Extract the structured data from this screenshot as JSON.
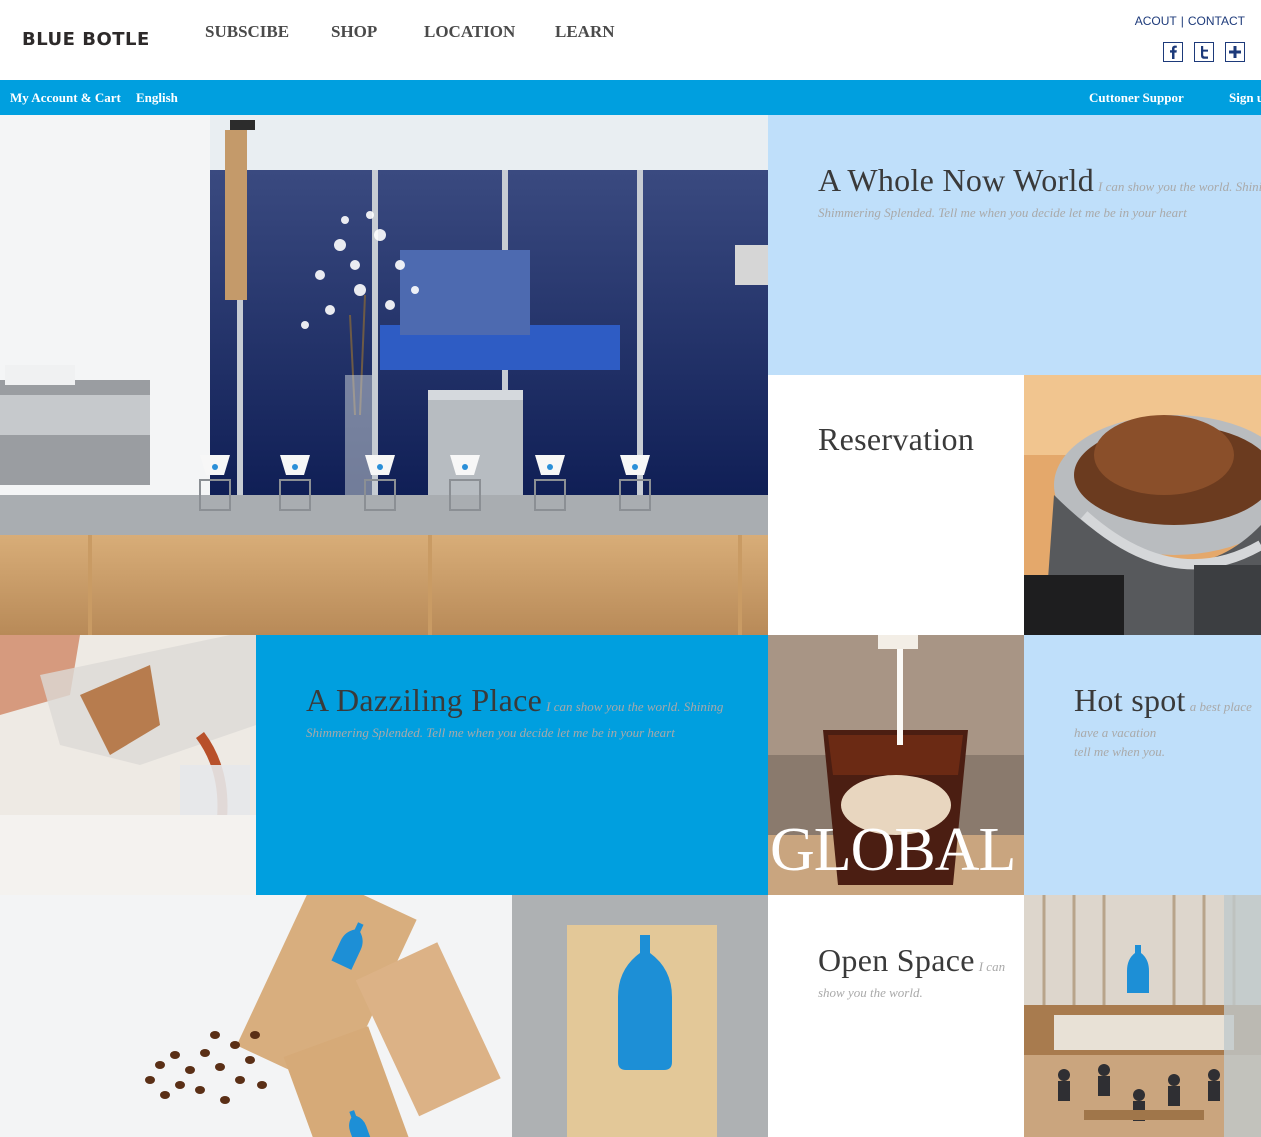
{
  "header": {
    "logo": "BLUE BOTLE",
    "nav": [
      "SUBSCIBE",
      "SHOP",
      "LOCATION",
      "LEARN"
    ],
    "top_links": {
      "account": "ACOUT",
      "separator": "|",
      "contact": "CONTACT"
    },
    "social_icons": [
      "facebook-icon",
      "twitter-icon",
      "plus-icon"
    ],
    "accent_color": "#1d3a7a"
  },
  "bar": {
    "color": "#009fdf",
    "left_links": [
      "My Account & Cart",
      "English"
    ],
    "right_links": [
      "Cuttoner Suppor",
      "Sign u"
    ]
  },
  "tiles": {
    "whole_world": {
      "title": "A Whole Now World",
      "subtitle_line1": "I can show you the world. Shinin",
      "subtitle_line2": "Shimmering Splended. Tell me when you decide let me be in your heart",
      "bg": "#bfdffa"
    },
    "reservation": {
      "title": "Reservation"
    },
    "dazzling": {
      "title": "A Dazziling Place",
      "subtitle_line1": "I can show you the world. Shining",
      "subtitle_line2": "Shimmering Splended. Tell me when you decide let me be in your heart",
      "bg": "#009fdf"
    },
    "global": {
      "label": "GLOBAL"
    },
    "hot_spot": {
      "title": "Hot spot",
      "subtitle_line1": "a best place",
      "subtitle_line2": "have a vacation",
      "subtitle_line3": "tell me when you.",
      "bg": "#bfdffa"
    },
    "open_space": {
      "title": "Open Space",
      "subtitle_line1": "I can",
      "subtitle_line2": "show you the world."
    }
  }
}
